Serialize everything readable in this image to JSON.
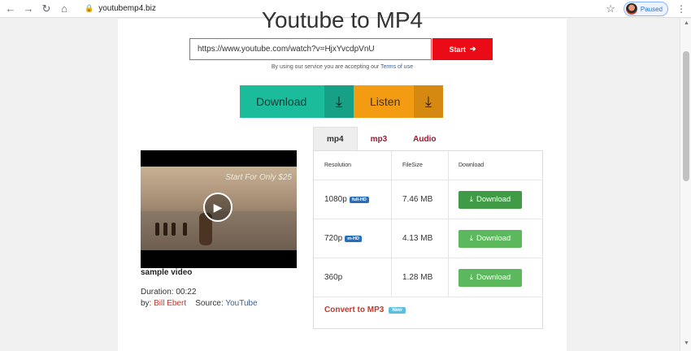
{
  "browser": {
    "url": "youtubemp4.biz",
    "profile_status": "Paused",
    "back_icon": "back-arrow-icon",
    "forward_icon": "forward-arrow-icon",
    "reload_icon": "reload-icon",
    "home_icon": "home-icon"
  },
  "page": {
    "title": "Youtube to MP4",
    "url_input_value": "https://www.youtube.com/watch?v=HjxYvcdpVnU",
    "start_label": "Start",
    "terms_text": "By using our service you are accepting our",
    "terms_link": "Terms of use",
    "download_big": "Download",
    "listen_big": "Listen"
  },
  "tabs": [
    "mp4",
    "mp3",
    "Audio"
  ],
  "video": {
    "overlay_text": "Start For Only $25",
    "title": "sample video",
    "duration_label": "Duration:",
    "duration_value": "00:22",
    "by_label": "by:",
    "author": "Bill Ebert",
    "source_label": "Source:",
    "source": "YouTube"
  },
  "table": {
    "headers": [
      "Resolution",
      "FileSize",
      "Download"
    ],
    "rows": [
      {
        "resolution": "1080p",
        "badge": "full-HD",
        "size": "7.46 MB",
        "button": "Download"
      },
      {
        "resolution": "720p",
        "badge": "m-HD",
        "size": "4.13 MB",
        "button": "Download"
      },
      {
        "resolution": "360p",
        "badge": "",
        "size": "1.28 MB",
        "button": "Download"
      }
    ],
    "convert": "Convert to MP3",
    "new_badge": "New"
  }
}
